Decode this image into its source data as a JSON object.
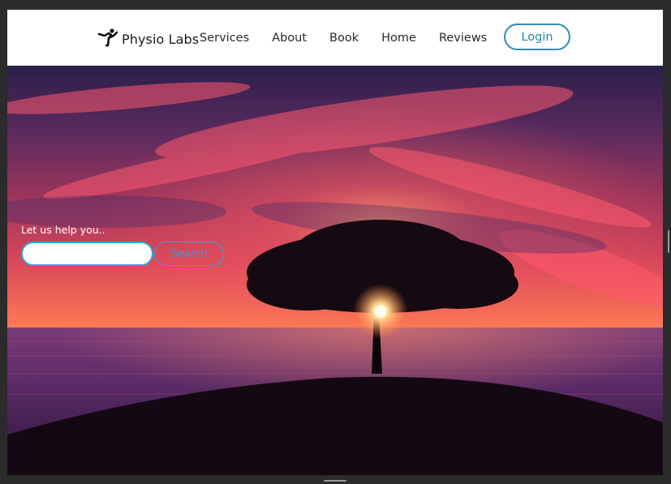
{
  "navbar": {
    "brand": {
      "name": "Physio Labs",
      "icon": "running-person-icon"
    },
    "links": [
      "Services",
      "About",
      "Book",
      "Home",
      "Reviews"
    ],
    "login_label": "Login",
    "accent_color": "#2f8fb6"
  },
  "hero": {
    "help_label": "Let us help you..",
    "search": {
      "value": "",
      "placeholder": "",
      "button_label": "Search"
    },
    "image": "sunset-tree-landscape"
  }
}
